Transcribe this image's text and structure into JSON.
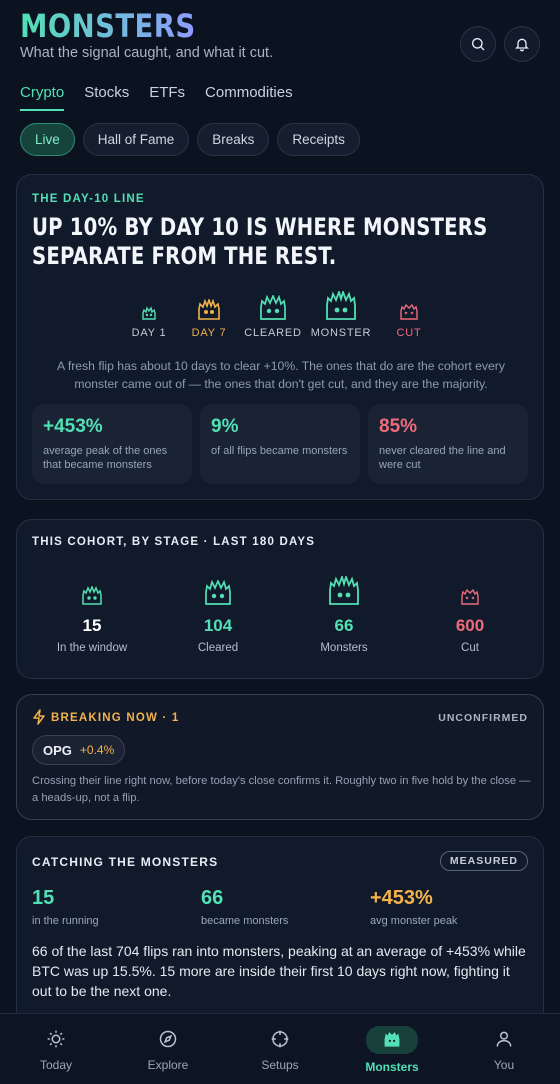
{
  "header": {
    "brand": "MONSTERS",
    "tagline": "What the signal caught, and what it cut."
  },
  "tabs": [
    "Crypto",
    "Stocks",
    "ETFs",
    "Commodities"
  ],
  "pills": [
    "Live",
    "Hall of Fame",
    "Breaks",
    "Receipts"
  ],
  "day10": {
    "eyebrow": "THE DAY-10 LINE",
    "headline": "Up 10% by day 10 is where monsters separate from the rest.",
    "stages": [
      {
        "label": "DAY 1",
        "color": "#52e0b4"
      },
      {
        "label": "DAY 7",
        "color": "#f3b24a"
      },
      {
        "label": "CLEARED",
        "color": "#52e0b4"
      },
      {
        "label": "MONSTER",
        "color": "#52e0b4"
      },
      {
        "label": "CUT",
        "color": "#ef6b7b"
      }
    ],
    "description": "A fresh flip has about 10 days to clear +10%. The ones that do are the cohort every monster came out of — the ones that don't get cut, and they are the majority.",
    "stats": [
      {
        "value": "+453%",
        "text": "average peak of the ones that became monsters",
        "color": "#52e0b4"
      },
      {
        "value": "9%",
        "text": "of all flips became monsters",
        "color": "#52e0b4"
      },
      {
        "value": "85%",
        "text": "never cleared the line and were cut",
        "color": "#ef6b7b"
      }
    ]
  },
  "cohort": {
    "eyebrow": "THIS COHORT, BY STAGE · LAST 180 DAYS",
    "items": [
      {
        "value": "15",
        "label": "In the window",
        "color": "#ffffff"
      },
      {
        "value": "104",
        "label": "Cleared",
        "color": "#52e0b4"
      },
      {
        "value": "66",
        "label": "Monsters",
        "color": "#52e0b4"
      },
      {
        "value": "600",
        "label": "Cut",
        "color": "#ef6b7b"
      }
    ]
  },
  "breaking": {
    "eyebrow": "BREAKING NOW · 1",
    "status": "UNCONFIRMED",
    "ticker": "OPG",
    "change": "+0.4%",
    "description": "Crossing their line right now, before today's close confirms it. Roughly two in five hold by the close — a heads-up, not a flip."
  },
  "catching": {
    "eyebrow": "CATCHING THE MONSTERS",
    "badge": "MEASURED",
    "stats": [
      {
        "value": "15",
        "label": "in the running",
        "color": "#52e0b4"
      },
      {
        "value": "66",
        "label": "became monsters",
        "color": "#52e0b4"
      },
      {
        "value": "+453%",
        "label": "avg monster peak",
        "color": "#f3b24a"
      }
    ],
    "paragraph": "66 of the last 704 flips ran into monsters, peaking at an average of +453% while BTC was up 15.5%. 15 more are inside their first 10 days right now, fighting it out to be the next one."
  },
  "nav": [
    "Today",
    "Explore",
    "Setups",
    "Monsters",
    "You"
  ]
}
